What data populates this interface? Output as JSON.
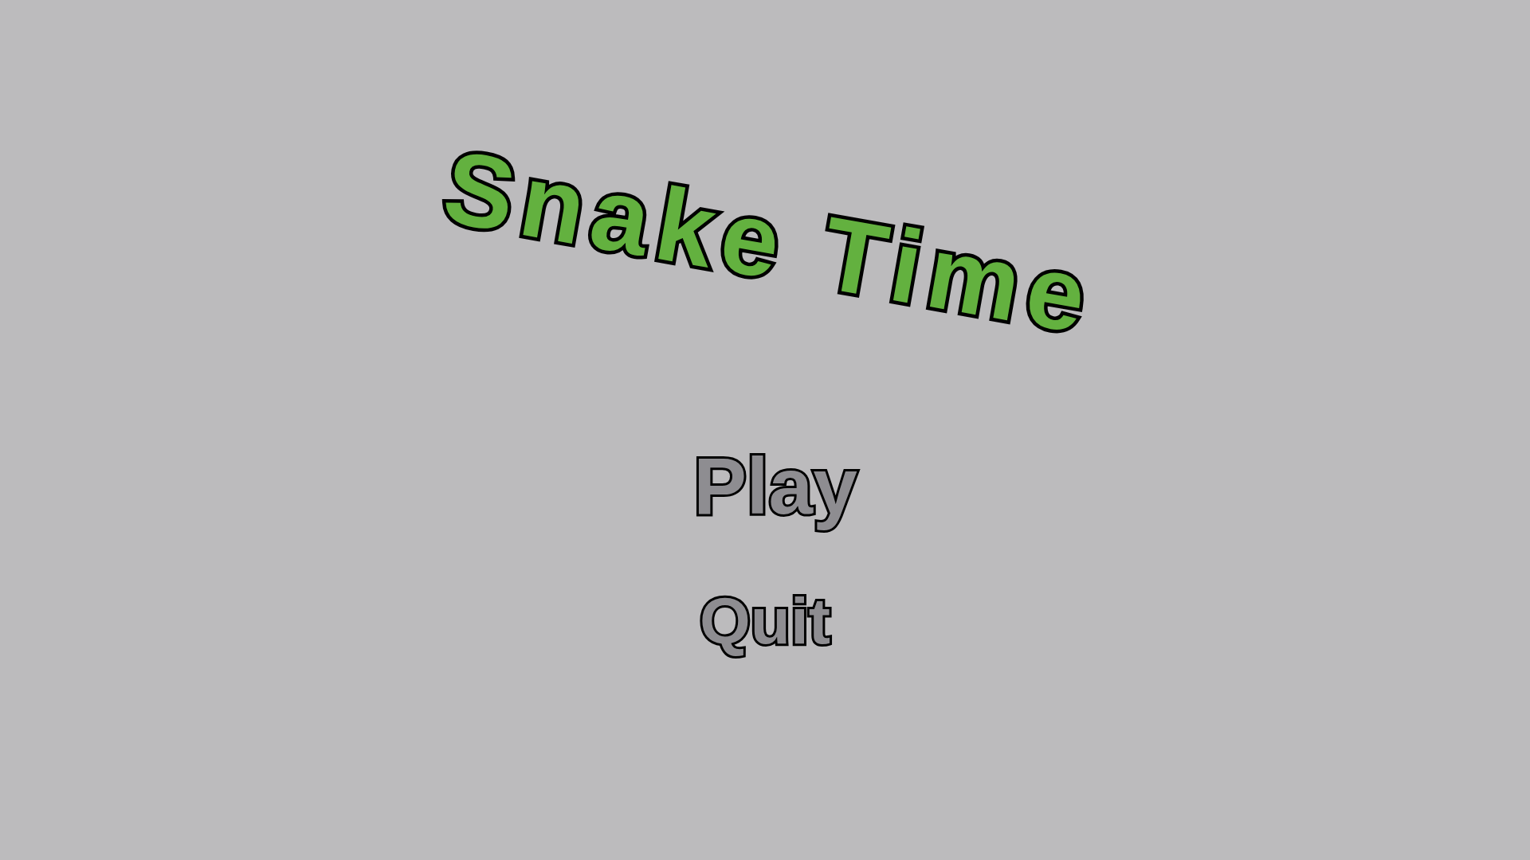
{
  "title": "Snake Time",
  "menu": [
    {
      "label": "Play",
      "selected": true
    },
    {
      "label": "Quit",
      "selected": false
    }
  ]
}
